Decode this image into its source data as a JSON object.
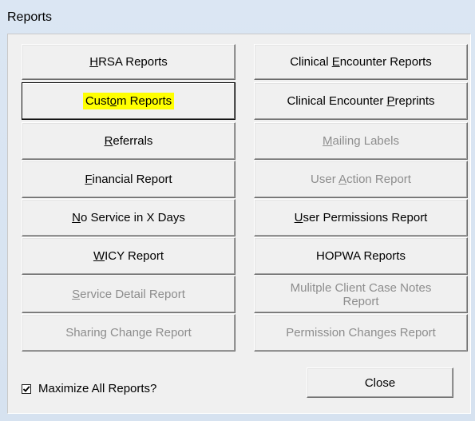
{
  "window": {
    "title": "Reports"
  },
  "buttons": {
    "hrsa": {
      "pre": "",
      "key": "H",
      "post": "RSA Reports",
      "enabled": true
    },
    "custom": {
      "pre": "Cust",
      "key": "o",
      "post": "m Reports",
      "enabled": true,
      "focused": true
    },
    "referrals": {
      "pre": "",
      "key": "R",
      "post": "eferrals",
      "enabled": true
    },
    "financial": {
      "pre": "",
      "key": "F",
      "post": "inancial Report",
      "enabled": true
    },
    "no_service": {
      "pre": "",
      "key": "N",
      "post": "o Service in X Days",
      "enabled": true
    },
    "wicy": {
      "pre": "",
      "key": "W",
      "post": "ICY Report",
      "enabled": true
    },
    "service_detail": {
      "pre": "",
      "key": "S",
      "post": "ervice Detail Report",
      "enabled": false
    },
    "sharing_change": {
      "pre": "",
      "key": "",
      "post": "Sharing Change Report",
      "enabled": false
    },
    "clinical_encounter": {
      "pre": "Clinical ",
      "key": "E",
      "post": "ncounter Reports",
      "enabled": true
    },
    "clinical_preprints": {
      "pre": "Clinical Encounter ",
      "key": "P",
      "post": "reprints",
      "enabled": true
    },
    "mailing_labels": {
      "pre": "",
      "key": "M",
      "post": "ailing Labels",
      "enabled": false
    },
    "user_action": {
      "pre": "User ",
      "key": "A",
      "post": "ction Report",
      "enabled": false
    },
    "user_permissions": {
      "pre": "",
      "key": "U",
      "post": "ser Permissions Report",
      "enabled": true
    },
    "hopwa": {
      "pre": "",
      "key": "",
      "post": "HOPWA Reports",
      "enabled": true
    },
    "multiple_notes": {
      "line1": "Mulitple Client Case Notes",
      "line2": "Report",
      "enabled": false
    },
    "permission_changes": {
      "pre": "",
      "key": "",
      "post": "Permission Changes Report",
      "enabled": false
    }
  },
  "maximize": {
    "label": "Maximize All Reports?",
    "checked": true
  },
  "close": {
    "label": "Close"
  }
}
